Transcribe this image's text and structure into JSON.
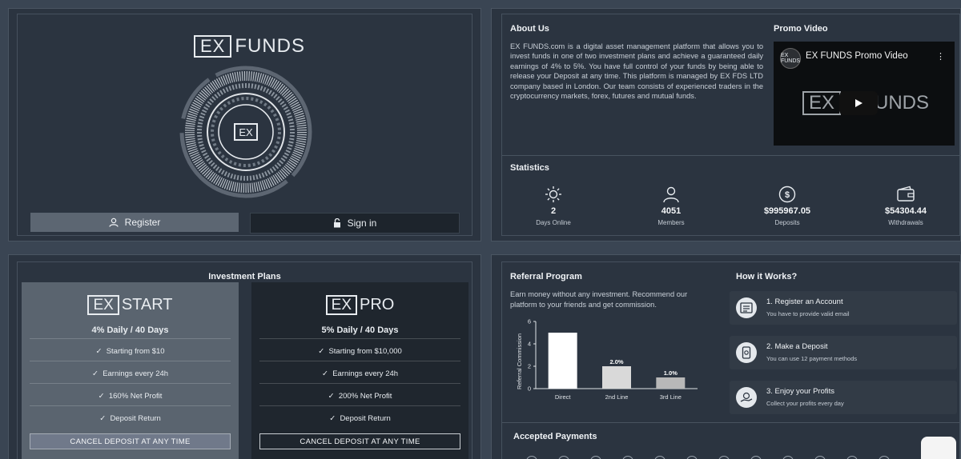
{
  "hero": {
    "logo_box": "EX",
    "logo_word": "FUNDS",
    "emblem_text": "EX",
    "register_label": "Register",
    "signin_label": "Sign in"
  },
  "about": {
    "title": "About Us",
    "text": "EX FUNDS.com is a digital asset management platform that allows you to invest funds in one of two investment plans and achieve a guaranteed daily earnings of 4% to 5%. You have full control of your funds by being able to release your Deposit at any time. This platform is managed by EX FDS LTD company based in London. Our team consists of experienced traders in the cryptocurrency markets, forex, futures and mutual funds.",
    "video_heading": "Promo Video",
    "video_title": "EX FUNDS Promo Video",
    "video_channel_logo": "EX FUNDS",
    "video_logo_box": "EX",
    "video_logo_word": "UNDS"
  },
  "statistics": {
    "title": "Statistics",
    "items": [
      {
        "icon": "sun-icon",
        "value": "2",
        "label": "Days Online"
      },
      {
        "icon": "user-icon",
        "value": "4051",
        "label": "Members"
      },
      {
        "icon": "dollar-icon",
        "value": "$995967.05",
        "label": "Deposits"
      },
      {
        "icon": "wallet-icon",
        "value": "$54304.44",
        "label": "Withdrawals"
      }
    ]
  },
  "investment": {
    "title": "Investment Plans",
    "plans": [
      {
        "logo_box": "EX",
        "logo_word": "START",
        "rate": "4% Daily / 40 Days",
        "features": [
          "Starting from $10",
          "Earnings every 24h",
          "160% Net Profit",
          "Deposit Return"
        ],
        "cancel_label": "CANCEL DEPOSIT AT ANY TIME"
      },
      {
        "logo_box": "EX",
        "logo_word": "PRO",
        "rate": "5% Daily / 40 Days",
        "features": [
          "Starting from $10,000",
          "Earnings every 24h",
          "200% Net Profit",
          "Deposit Return"
        ],
        "cancel_label": "CANCEL DEPOSIT AT ANY TIME"
      }
    ]
  },
  "referral": {
    "title": "Referral Program",
    "text": "Earn money without any investment. Recommend our platform to your friends and get commission."
  },
  "chart_data": {
    "type": "bar",
    "categories": [
      "Direct",
      "2nd Line",
      "3rd Line"
    ],
    "values": [
      5,
      2,
      1
    ],
    "data_labels": [
      "",
      "2.0%",
      "1.0%"
    ],
    "ylabel": "Referral Commission",
    "ylim": [
      0,
      6
    ],
    "yticks": [
      "0",
      "2",
      "4",
      "6"
    ],
    "grid": false,
    "colors": [
      "#ffffff",
      "#d9d9d9",
      "#b8b8b8"
    ]
  },
  "how_it_works": {
    "title": "How it Works?",
    "steps": [
      {
        "icon": "account-icon",
        "title": "1. Register an Account",
        "desc": "You have to provide valid email"
      },
      {
        "icon": "deposit-icon",
        "title": "2. Make a Deposit",
        "desc": "You can use 12 payment methods"
      },
      {
        "icon": "profits-icon",
        "title": "3. Enjoy your Profits",
        "desc": "Collect your profits every day"
      }
    ]
  },
  "payments": {
    "title": "Accepted Payments"
  }
}
